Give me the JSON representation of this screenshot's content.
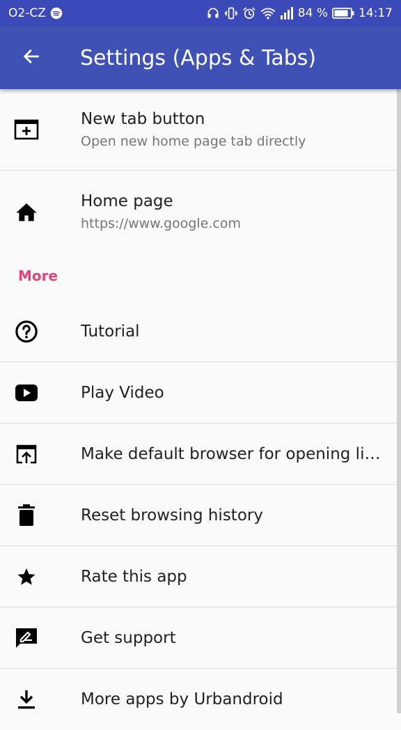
{
  "status_bar": {
    "carrier": "O2-CZ",
    "battery_percent": "84 %",
    "time": "14:17",
    "icons": [
      "spotify-icon",
      "headphones-icon",
      "vibrate-icon",
      "alarm-icon",
      "wifi-icon",
      "signal-icon",
      "battery-icon"
    ]
  },
  "app_bar": {
    "back_icon": "arrow-back-icon",
    "title": "Settings (Apps & Tabs)",
    "color": "#3f51b5"
  },
  "items_top": [
    {
      "title": "New tab button",
      "subtitle": "Open new home page tab directly",
      "icon": "new-tab-icon"
    },
    {
      "title": "Home page",
      "subtitle": "https://www.google.com",
      "icon": "home-icon"
    }
  ],
  "section_more": {
    "label": "More",
    "color": "#e0457b"
  },
  "items_more": [
    {
      "title": "Tutorial",
      "icon": "help-icon"
    },
    {
      "title": "Play Video",
      "icon": "play-video-icon"
    },
    {
      "title": "Make default browser for opening lin…",
      "icon": "open-in-browser-icon"
    },
    {
      "title": "Reset browsing history",
      "icon": "trash-icon"
    },
    {
      "title": "Rate this app",
      "icon": "star-icon"
    },
    {
      "title": "Get support",
      "icon": "feedback-icon"
    },
    {
      "title": "More apps by Urbandroid",
      "icon": "download-icon"
    }
  ]
}
